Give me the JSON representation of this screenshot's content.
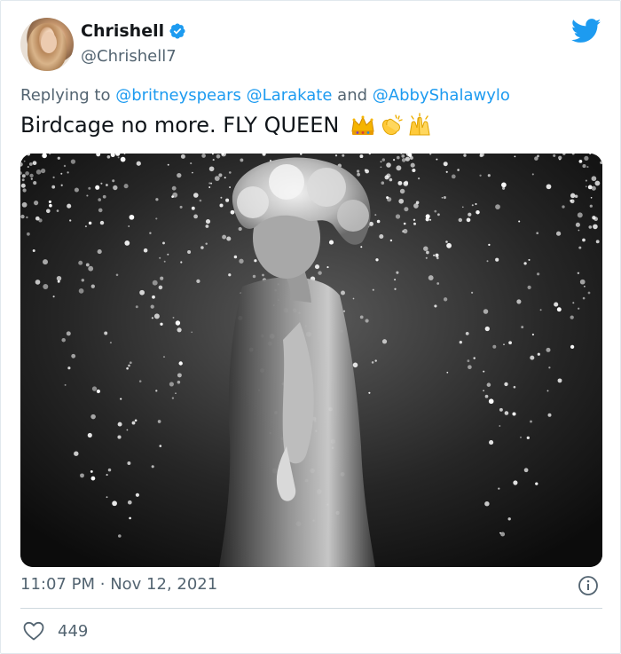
{
  "tweet": {
    "author": {
      "display_name": "Chrishell",
      "handle": "@Chrishell7",
      "verified": true,
      "avatar_icon": "avatar-photo"
    },
    "reply": {
      "prefix": "Replying to",
      "mentions": [
        "@britneyspears",
        "@Larakate",
        "@AbbyShalawylo"
      ],
      "joiner": "and"
    },
    "text": "Birdcage no more. FLY QUEEN",
    "emojis": [
      "crown-emoji",
      "clapping-hands-emoji",
      "raising-hands-emoji"
    ],
    "time": "11:07 PM",
    "separator": "·",
    "date": "Nov 12, 2021",
    "likes": "449"
  },
  "icons": {
    "brand": "twitter-bird-icon",
    "verified": "verified-badge-icon",
    "info": "info-icon",
    "like": "heart-icon"
  },
  "colors": {
    "accent": "#1d9bf0",
    "muted": "#536471",
    "text": "#0f1419",
    "border": "#cfd9de"
  }
}
